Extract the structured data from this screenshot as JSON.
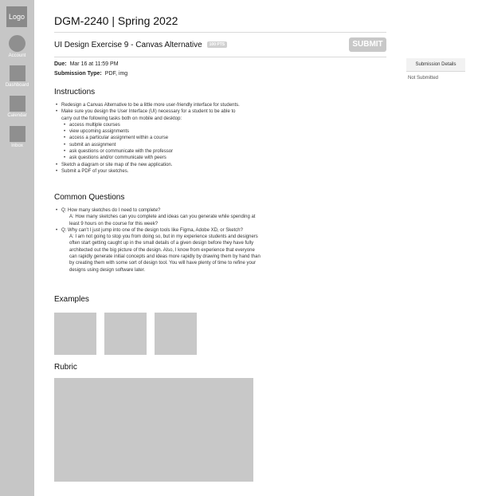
{
  "sidebar": {
    "logo": "Logo",
    "items": [
      {
        "label": "Account",
        "icon": "account-icon"
      },
      {
        "label": "Dashboard",
        "icon": "dashboard-icon"
      },
      {
        "label": "Calendar",
        "icon": "calendar-icon"
      },
      {
        "label": "Inbox",
        "icon": "inbox-icon"
      }
    ]
  },
  "course": {
    "title": "DGM-2240 | Spring 2022"
  },
  "assignment": {
    "title": "UI Design Exercise 9 - Canvas Alternative",
    "points": "100 PTS",
    "submit_label": "SUBMIT",
    "due_label": "Due:",
    "due_value": "Mar 16 at 11:59 PM",
    "submission_type_label": "Submission Type:",
    "submission_type_value": "PDF, img"
  },
  "submission_panel": {
    "title": "Submission Details",
    "status": "Not Submitted"
  },
  "instructions": {
    "heading": "Instructions",
    "items": [
      "Redesign a Canvas Alternative to be a little more user-friendly interface for students.",
      "Make sure you design the User Interface (UI) necessary for a student to be able to carry out the following tasks both on mobile and desktop:",
      "Sketch a diagram or site map of the new application.",
      "Submit a PDF of your sketches."
    ],
    "tasks": [
      "access multiple courses",
      "view upcoming assignments",
      "access a particular assignment within a course",
      "submit an assignment",
      "ask questions or communicate with the professor",
      "ask questions and/or communicate with peers"
    ]
  },
  "questions": {
    "heading": "Common Questions",
    "items": [
      {
        "q": "Q: How many sketches do I need to complete?",
        "a": "A: How many sketches can you complete and ideas can you generate while spending at least 9 hours on the course for this week?"
      },
      {
        "q": "Q: Why can't I just jump into one of the design tools like Figma, Adobe XD, or Sketch?",
        "a": "A: I am not going to stop you from doing so, but in my experience students and designers often start getting caught up in the small details of a given design before they have fully architected out the big picture of the design. Also, I know from experience that everyone can rapidly generate initial concepts and ideas more rapidly by drawing them by hand than by creating them with some sort of design tool. You will have plenty of time to refine your designs using design software later."
      }
    ]
  },
  "examples": {
    "heading": "Examples"
  },
  "rubric": {
    "heading": "Rubric"
  }
}
